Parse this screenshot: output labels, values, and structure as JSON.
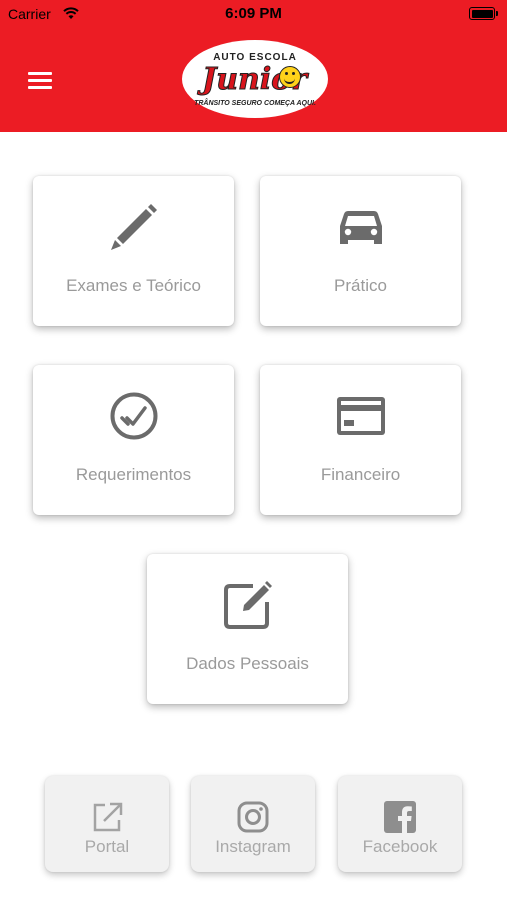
{
  "status": {
    "carrier": "Carrier",
    "time": "6:09 PM"
  },
  "header": {
    "logo_top": "AUTO ESCOLA",
    "logo_main": "Junior",
    "logo_bottom": "TRÂNSITO SEGURO COMEÇA AQUI."
  },
  "colors": {
    "brand_red": "#ec1c24",
    "icon_gray": "#6b6b6b",
    "label_gray": "#9a9a9a"
  },
  "menu": [
    {
      "label": "Exames e Teórico",
      "icon": "pencil-icon"
    },
    {
      "label": "Prático",
      "icon": "car-icon"
    },
    {
      "label": "Requerimentos",
      "icon": "check-circle-icon"
    },
    {
      "label": "Financeiro",
      "icon": "credit-card-icon"
    },
    {
      "label": "Dados Pessoais",
      "icon": "edit-square-icon"
    }
  ],
  "links": [
    {
      "label": "Portal",
      "icon": "external-link-icon"
    },
    {
      "label": "Instagram",
      "icon": "instagram-icon"
    },
    {
      "label": "Facebook",
      "icon": "facebook-icon"
    }
  ]
}
